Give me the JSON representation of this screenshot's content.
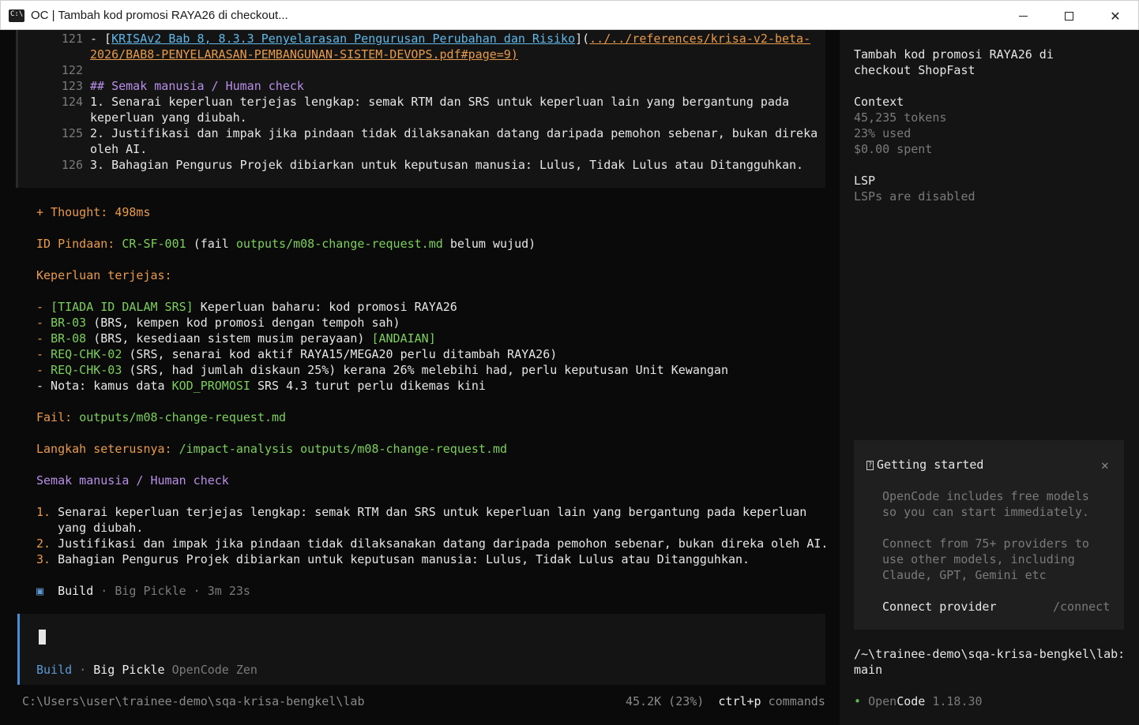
{
  "window": {
    "title": "OC | Tambah kod promosi RAYA26 di checkout..."
  },
  "code_block": {
    "lines": [
      {
        "num": "121",
        "text_1_prefix": "- [",
        "text_1_link": "KRISAv2 Bab 8, 8.3.3 Penyelarasan Pengurusan Perubahan dan Risiko",
        "text_1_mid": "](",
        "text_1_path": "../../references/krisa-v2-beta-",
        "text_2_path": "2026/BAB8-PENYELARASAN-PEMBANGUNAN-SISTEM-DEVOPS.pdf#page=9)"
      },
      {
        "num": "122"
      },
      {
        "num": "123",
        "text": "## Semak manusia / Human check"
      },
      {
        "num": "124",
        "text": "1. Senarai keperluan terjejas lengkap: semak RTM dan SRS untuk keperluan lain yang bergantung pada",
        "text_cont": "keperluan yang diubah."
      },
      {
        "num": "125",
        "text": "2. Justifikasi dan impak jika pindaan tidak dilaksanakan datang daripada pemohon sebenar, bukan direka",
        "text_cont": "oleh AI."
      },
      {
        "num": "126",
        "text": "3. Bahagian Pengurus Projek dibiarkan untuk keputusan manusia: Lulus, Tidak Lulus atau Ditangguhkan."
      }
    ]
  },
  "response": {
    "thought": "+ Thought: 498ms",
    "id_label": "ID Pindaan:",
    "id_value": "CR-SF-001",
    "id_fail_prefix": "(fail",
    "id_fail_path": "outputs/m08-change-request.md",
    "id_fail_suffix": "belum wujud)",
    "affected_heading": "Keperluan terjejas:",
    "items": [
      {
        "dash": "-",
        "tag": "[TIADA ID DALAM SRS]",
        "text": "Keperluan baharu: kod promosi RAYA26"
      },
      {
        "dash": "-",
        "tag": "BR-03",
        "text": "(BRS, kempen kod promosi dengan tempoh sah)"
      },
      {
        "dash": "-",
        "tag": "BR-08",
        "text": "(BRS, kesediaan sistem musim perayaan)",
        "tag2": "[ANDAIAN]"
      },
      {
        "dash": "-",
        "tag": "REQ-CHK-02",
        "text": "(SRS, senarai kod aktif RAYA15/MEGA20 perlu ditambah RAYA26)"
      },
      {
        "dash": "-",
        "tag": "REQ-CHK-03",
        "text": "(SRS, had jumlah diskaun 25%) kerana 26% melebihi had, perlu keputusan Unit Kewangan"
      }
    ],
    "note_prefix": "- Nota: kamus data",
    "note_tag": "KOD_PROMOSI",
    "note_suffix": "SRS 4.3 turut perlu dikemas kini",
    "file_label": "Fail:",
    "file_path": "outputs/m08-change-request.md",
    "next_label": "Langkah seterusnya:",
    "next_cmd": "/impact-analysis outputs/m08-change-request.md",
    "human_heading": "Semak manusia / Human check",
    "checks": [
      {
        "num": "1.",
        "text": "Senarai keperluan terjejas lengkap: semak RTM dan SRS untuk keperluan lain yang bergantung pada keperluan",
        "cont": "yang diubah."
      },
      {
        "num": "2.",
        "text": "Justifikasi dan impak jika pindaan tidak dilaksanakan datang daripada pemohon sebenar, bukan direka oleh AI."
      },
      {
        "num": "3.",
        "text": "Bahagian Pengurus Projek dibiarkan untuk keputusan manusia: Lulus, Tidak Lulus atau Ditangguhkan."
      }
    ],
    "footer_mode": "Build",
    "footer_model": "· Big Pickle · 3m 23s"
  },
  "input": {
    "mode": "Build",
    "sep": "·",
    "model": "Big Pickle",
    "provider": "OpenCode Zen"
  },
  "statusbar": {
    "cwd": "C:\\Users\\user\\trainee-demo\\sqa-krisa-bengkel\\lab",
    "tokens": "45.2K (23%)",
    "shortcut_key": "ctrl+p",
    "shortcut_label": "commands"
  },
  "sidebar": {
    "session_title_1": "Tambah kod promosi RAYA26 di",
    "session_title_2": "checkout ShopFast",
    "context_heading": "Context",
    "context_tokens": "45,235 tokens",
    "context_used": "23% used",
    "context_spent": "$0.00 spent",
    "lsp_heading": "LSP",
    "lsp_status": "LSPs are disabled",
    "card": {
      "title": "Getting started",
      "p1_l1": "OpenCode includes free models",
      "p1_l2": "so you can start immediately.",
      "p2_l1": "Connect from 75+ providers to",
      "p2_l2": "use other models, including",
      "p2_l3": "Claude, GPT, Gemini etc",
      "action_label": "Connect provider",
      "action_cmd": "/connect"
    },
    "path_1": "/~\\trainee-demo\\sqa-krisa-bengkel\\lab:",
    "path_2": "main",
    "app_name_1": "Open",
    "app_name_2": "Code",
    "app_version": "1.18.30"
  }
}
